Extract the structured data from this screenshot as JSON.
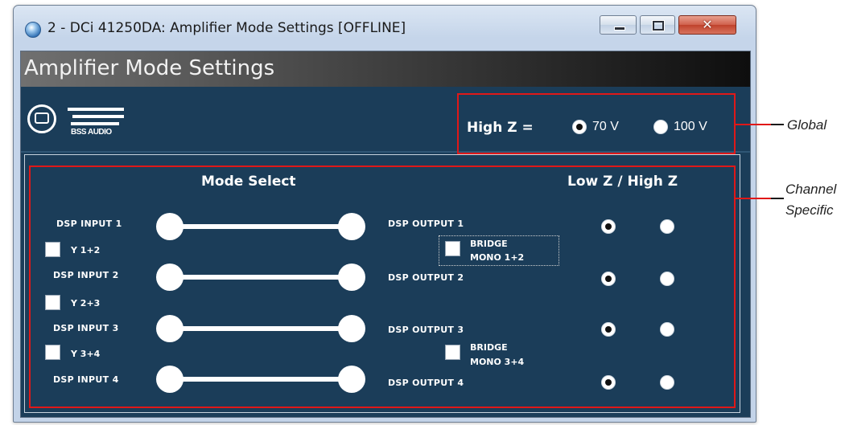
{
  "window": {
    "title": "2 - DCi 41250DA: Amplifier Mode Settings [OFFLINE]",
    "close_glyph": "✕"
  },
  "header": {
    "title": "Amplifier Mode Settings"
  },
  "logo": {
    "text": "BSS AUDIO"
  },
  "global": {
    "label": "High Z =",
    "options": [
      {
        "label": "70 V",
        "selected": true
      },
      {
        "label": "100 V",
        "selected": false
      }
    ]
  },
  "mode_select": {
    "heading": "Mode Select",
    "inputs": [
      "DSP INPUT 1",
      "DSP INPUT 2",
      "DSP INPUT 3",
      "DSP INPUT 4"
    ],
    "outputs": [
      "DSP OUTPUT 1",
      "DSP OUTPUT 2",
      "DSP OUTPUT 3",
      "DSP OUTPUT 4"
    ],
    "y_links": [
      {
        "label": "Y 1+2",
        "checked": false
      },
      {
        "label": "Y 2+3",
        "checked": false
      },
      {
        "label": "Y 3+4",
        "checked": false
      }
    ],
    "bridges": [
      {
        "line1": "BRIDGE",
        "line2": "MONO 1+2",
        "checked": false
      },
      {
        "line1": "BRIDGE",
        "line2": "MONO 3+4",
        "checked": false
      }
    ]
  },
  "impedance": {
    "heading": "Low Z / High Z",
    "channels": [
      {
        "selected": "low"
      },
      {
        "selected": "low"
      },
      {
        "selected": "low"
      },
      {
        "selected": "low"
      }
    ]
  },
  "annotations": {
    "global": "Global",
    "channel_line1": "Channel",
    "channel_line2": "Specific"
  },
  "colors": {
    "panel_bg": "#1b3d59",
    "highlight_red": "#e01818",
    "header_dark": "#0e0e0e"
  }
}
